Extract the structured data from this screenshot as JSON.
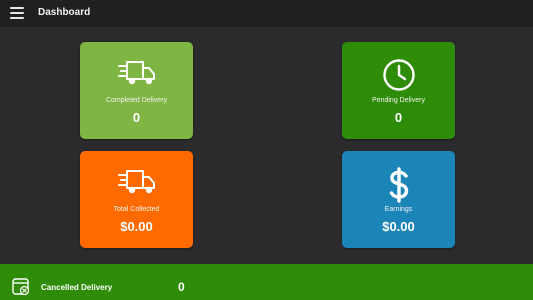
{
  "header": {
    "title": "Dashboard",
    "menu_icon": "hamburger-menu-icon"
  },
  "cards": {
    "completed": {
      "label": "Completed Delivery",
      "value": "0",
      "icon": "delivery-truck-icon",
      "color": "#7fb542"
    },
    "pending": {
      "label": "Pending Delivery",
      "value": "0",
      "icon": "clock-icon",
      "color": "#2e8c08"
    },
    "collected": {
      "label": "Total Collected",
      "value": "$0.00",
      "icon": "delivery-truck-icon",
      "color": "#ff6a00"
    },
    "earnings": {
      "label": "Earnings",
      "value": "$0.00",
      "icon": "dollar-icon",
      "color": "#1c85b8"
    }
  },
  "cancelled": {
    "label": "Cancelled Delivery",
    "value": "0",
    "icon": "cancelled-box-icon",
    "color": "#2e8c08"
  }
}
